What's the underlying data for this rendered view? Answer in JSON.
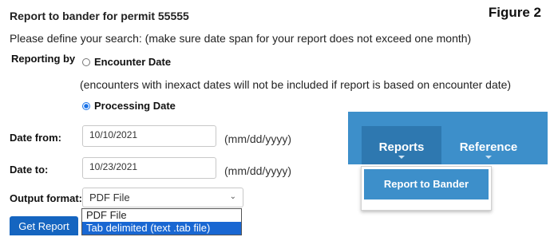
{
  "page": {
    "title": "Report to bander for permit 55555",
    "figure_label": "Figure 2",
    "intro": "Please define your search: (make sure date span for your report does not exceed one month)"
  },
  "reporting": {
    "label": "Reporting by",
    "options": [
      {
        "label": "Encounter Date",
        "checked": false
      },
      {
        "label": "Processing Date",
        "checked": true
      }
    ],
    "note": "(encounters with inexact dates will not be included if report is based on encounter date)"
  },
  "dates": {
    "from_label": "Date from:",
    "from_value": "10/10/2021",
    "to_label": "Date to:",
    "to_value": "10/23/2021",
    "format_hint": "(mm/dd/yyyy)"
  },
  "output": {
    "label": "Output format:",
    "selected": "PDF File",
    "options": [
      "PDF File",
      "Tab delimited (text .tab file)"
    ],
    "highlighted_option": "Tab delimited (text .tab file)"
  },
  "actions": {
    "get_report": "Get Report"
  },
  "nav_inset": {
    "items": [
      "Reports",
      "Reference"
    ],
    "dropdown_item": "Report to Bander"
  },
  "colors": {
    "nav_bg": "#3d8fca",
    "nav_active": "#2e78b0",
    "button": "#1565c0",
    "option_highlight": "#1967d2"
  }
}
